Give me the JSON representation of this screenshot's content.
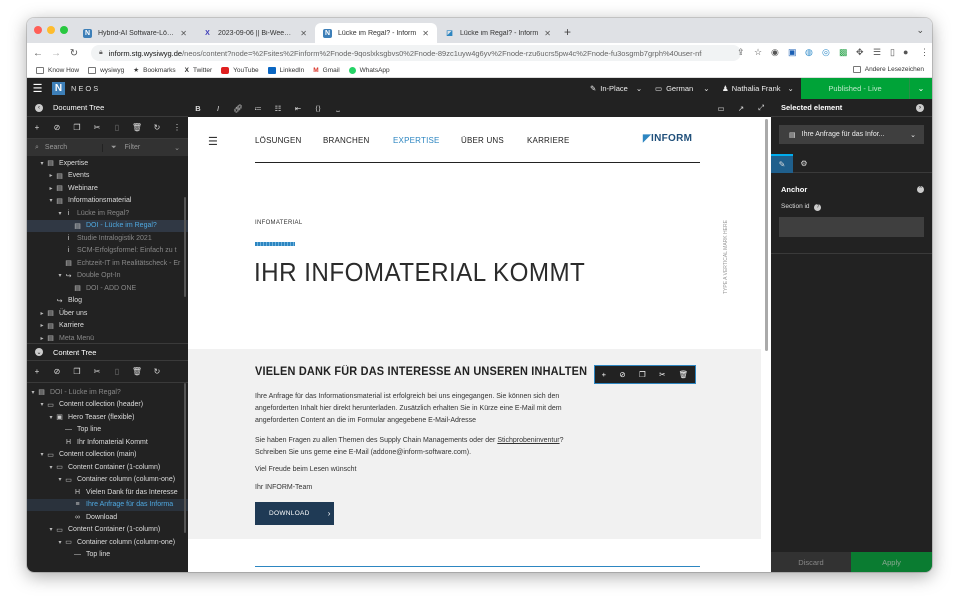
{
  "browser": {
    "tabs": [
      {
        "label": "Hybrid-AI Software-Lösungen",
        "favicon": "N"
      },
      {
        "label": "2023-09-06 || Bi-Weekly - INF",
        "favicon": "X"
      },
      {
        "label": "Lücke im Regal? - Inform",
        "favicon": "N"
      },
      {
        "label": "Lücke im Regal? - Inform",
        "favicon": "◪"
      }
    ],
    "url_domain": "inform.stg.wysiwyg.de",
    "url_rest": "/neos/content?node=%2Fsites%2Finform%2Fnode-9qoslxksgbvs0%2Fnode-89zc1uyw4g6yv%2Fnode-rzu6ucrs5pw4c%2Fnode-fu3osgmb7grph%40user-nfrank%...",
    "bookmarks": [
      "Know How",
      "wysiwyg",
      "Bookmarks",
      "Twitter",
      "YouTube",
      "LinkedIn",
      "Gmail",
      "WhatsApp"
    ],
    "bookmarks_right": "Andere Lesezeichen"
  },
  "neos": {
    "logo_text": "NEOS",
    "mode": "In-Place",
    "language": "German",
    "user": "Nathalia Frank",
    "publish_status": "Published - Live"
  },
  "document_tree": {
    "title": "Document Tree",
    "search_placeholder": "Search",
    "filter_placeholder": "Filter",
    "nodes": [
      {
        "label": "Expertise",
        "indent": 1,
        "arrow": "▾",
        "icon": "▤",
        "state": "normal"
      },
      {
        "label": "Events",
        "indent": 2,
        "arrow": "▸",
        "icon": "▤",
        "state": "normal"
      },
      {
        "label": "Webinare",
        "indent": 2,
        "arrow": "▸",
        "icon": "▤",
        "state": "normal"
      },
      {
        "label": "Informationsmaterial",
        "indent": 2,
        "arrow": "▾",
        "icon": "▤",
        "state": "normal"
      },
      {
        "label": "Lücke im Regal?",
        "indent": 3,
        "arrow": "▾",
        "icon": "i",
        "state": "dim"
      },
      {
        "label": "DOI - Lücke im Regal?",
        "indent": 4,
        "arrow": "",
        "icon": "▤",
        "state": "sel"
      },
      {
        "label": "Studie Intralogistik 2021",
        "indent": 3,
        "arrow": "",
        "icon": "i",
        "state": "dim"
      },
      {
        "label": "SCM-Erfolgsformel: Einfach zu t",
        "indent": 3,
        "arrow": "",
        "icon": "i",
        "state": "dim"
      },
      {
        "label": "Echtzeit-IT im Realitätscheck - Er",
        "indent": 3,
        "arrow": "",
        "icon": "▤",
        "state": "dim"
      },
      {
        "label": "Double Opt-In",
        "indent": 3,
        "arrow": "▾",
        "icon": "↪",
        "state": "dim"
      },
      {
        "label": "DOI - ADD ONE",
        "indent": 4,
        "arrow": "",
        "icon": "▤",
        "state": "dim"
      },
      {
        "label": "Blog",
        "indent": 2,
        "arrow": "",
        "icon": "↪",
        "state": "normal"
      },
      {
        "label": "Über uns",
        "indent": 1,
        "arrow": "▸",
        "icon": "▤",
        "state": "normal"
      },
      {
        "label": "Karriere",
        "indent": 1,
        "arrow": "▸",
        "icon": "▤",
        "state": "normal"
      },
      {
        "label": "Meta Menü",
        "indent": 1,
        "arrow": "▸",
        "icon": "▤",
        "state": "dim"
      }
    ]
  },
  "content_tree": {
    "title": "Content Tree",
    "nodes": [
      {
        "label": "DOI - Lücke im Regal?",
        "indent": 0,
        "arrow": "▾",
        "icon": "▤",
        "state": "dim"
      },
      {
        "label": "Content collection (header)",
        "indent": 1,
        "arrow": "▾",
        "icon": "▭",
        "state": "normal"
      },
      {
        "label": "Hero Teaser (flexible)",
        "indent": 2,
        "arrow": "▾",
        "icon": "▣",
        "state": "normal"
      },
      {
        "label": "Top line",
        "indent": 3,
        "arrow": "",
        "icon": "—",
        "state": "normal"
      },
      {
        "label": "Ihr Infomaterial Kommt",
        "indent": 3,
        "arrow": "",
        "icon": "H",
        "state": "normal"
      },
      {
        "label": "Content collection (main)",
        "indent": 1,
        "arrow": "▾",
        "icon": "▭",
        "state": "normal"
      },
      {
        "label": "Content Container (1-column)",
        "indent": 2,
        "arrow": "▾",
        "icon": "▭",
        "state": "normal"
      },
      {
        "label": "Container column (column-one)",
        "indent": 3,
        "arrow": "▾",
        "icon": "▭",
        "state": "normal"
      },
      {
        "label": "Vielen Dank für das Interesse",
        "indent": 4,
        "arrow": "",
        "icon": "H",
        "state": "normal"
      },
      {
        "label": "Ihre Anfrage für das Informa",
        "indent": 4,
        "arrow": "",
        "icon": "≡",
        "state": "hl"
      },
      {
        "label": "Download",
        "indent": 4,
        "arrow": "",
        "icon": "∞",
        "state": "normal"
      },
      {
        "label": "Content Container (1-column)",
        "indent": 2,
        "arrow": "▾",
        "icon": "▭",
        "state": "normal"
      },
      {
        "label": "Container column (column-one)",
        "indent": 3,
        "arrow": "▾",
        "icon": "▭",
        "state": "normal"
      },
      {
        "label": "Top line",
        "indent": 4,
        "arrow": "",
        "icon": "—",
        "state": "normal"
      }
    ]
  },
  "site": {
    "nav": [
      "LÖSUNGEN",
      "BRANCHEN",
      "EXPERTISE",
      "ÜBER UNS",
      "KARRIERE"
    ],
    "active_nav": "EXPERTISE",
    "brand": "INFORM",
    "topline": "INFOMATERIAL",
    "headline": "IHR INFOMATERIAL KOMMT",
    "vertical_mark": "TYPE A VERTICAL MARK HERE",
    "section_title": "VIELEN DANK FÜR DAS INTERESSE AN UNSEREN INHALTEN",
    "para1": "Ihre Anfrage für das Informationsmaterial ist erfolgreich bei uns eingegangen. Sie können sich den angeforderten Inhalt hier direkt herunterladen. Zusätzlich erhalten Sie in Kürze eine E-Mail mit dem angeforderten Content an die im Formular angegebene E-Mail-Adresse",
    "para2_a": "Sie haben Fragen zu allen Themen des Supply Chain Managements oder der ",
    "para2_link": "Stichprobeninventur",
    "para2_b": "? Schreiben Sie uns gerne eine E-Mail (addone@inform-software.com).",
    "para3": "Viel Freude beim Lesen wünscht",
    "para4": "Ihr INFORM-Team",
    "download_label": "DOWNLOAD"
  },
  "inspector": {
    "title": "Selected element",
    "selected": "Ihre Anfrage für das Infor...",
    "group": "Anchor",
    "field_label": "Section id",
    "discard": "Discard",
    "apply": "Apply"
  }
}
